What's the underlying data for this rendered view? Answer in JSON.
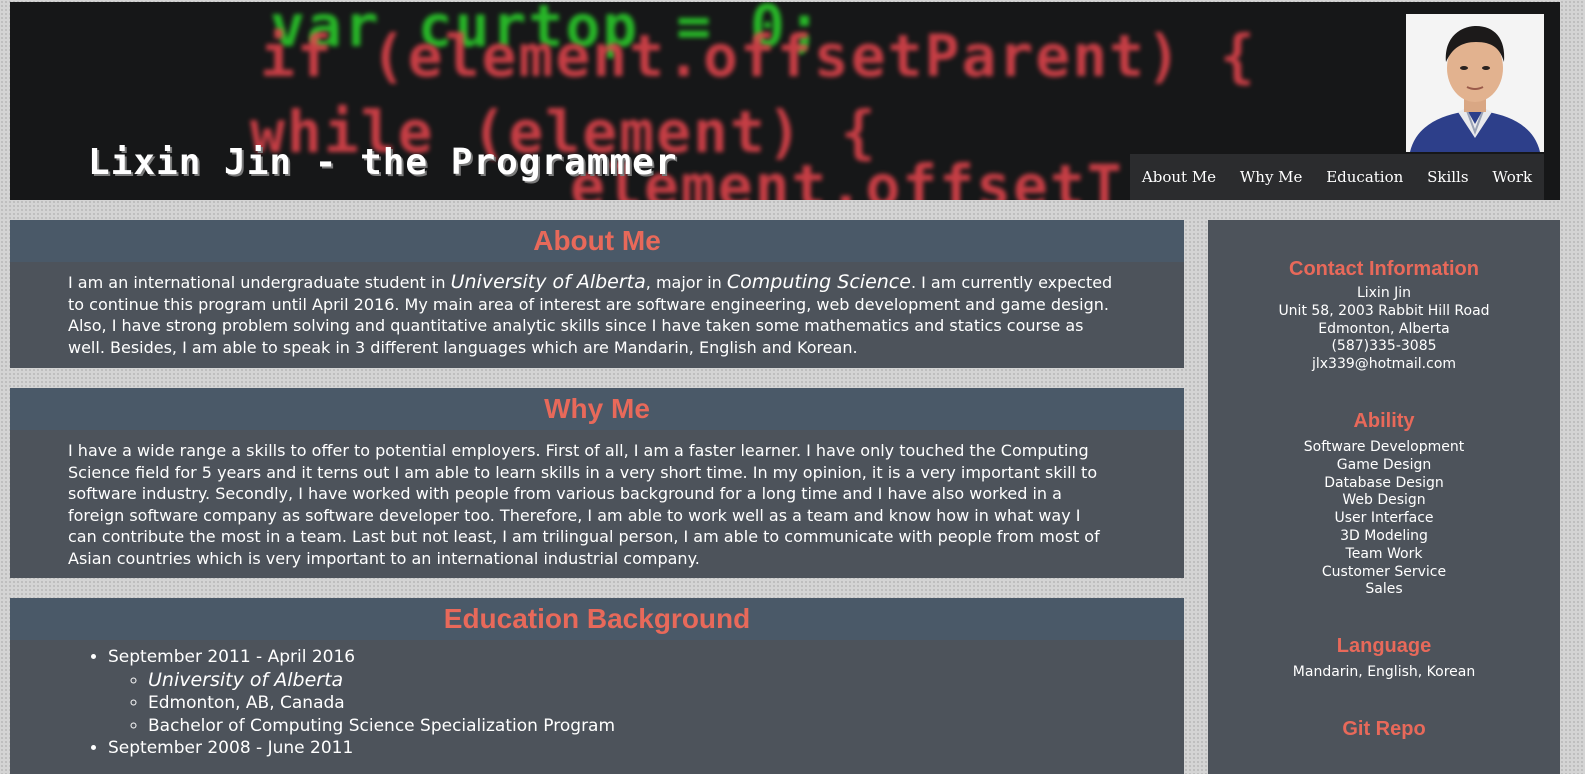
{
  "header": {
    "title": "Lixin Jin - the Programmer",
    "background_code": [
      {
        "text": "var curtop = 0;",
        "color": "#2bd22b"
      },
      {
        "text": "if (element.offsetParent)  {",
        "color": "#e5454d"
      },
      {
        "text": "while (element)  {",
        "color": "#e5454d"
      },
      {
        "text": "element.offsetT",
        "color": "#e5454d"
      }
    ]
  },
  "nav": {
    "items": [
      {
        "label": "About Me"
      },
      {
        "label": "Why Me"
      },
      {
        "label": "Education"
      },
      {
        "label": "Skills"
      },
      {
        "label": "Work"
      }
    ]
  },
  "about": {
    "heading": "About Me",
    "t1": "I am an international undergraduate student in ",
    "em1": "University of Alberta",
    "t2": ", major in ",
    "em2": "Computing Science",
    "t3": ". I am currently expected to continue this program until April 2016. My main area of interest are software engineering, web development and game design. Also, I have strong problem solving and quantitative analytic skills since I have taken some mathematics and statics course as well. Besides, I am able to speak in 3 different languages which are Mandarin, English and Korean."
  },
  "why": {
    "heading": "Why Me",
    "body": "I have a wide range a skills to offer to potential employers. First of all, I am a faster learner. I have only touched the Computing Science field for 5 years and it terns out I am able to learn skills in a very short time. In my opinion, it is a very important skill to software industry. Secondly, I have worked with people from various background for a long time and I have also worked in a foreign software company as software developer too. Therefore, I am able to work well as a team and know how in what way I can contribute the most in a team. Last but not least, I am trilingual person, I am able to communicate with people from most of Asian countries which is very important to an international industrial company."
  },
  "education": {
    "heading": "Education Background",
    "entries": [
      {
        "period": "September 2011 - April 2016",
        "school": "University of Alberta",
        "location": "Edmonton, AB, Canada",
        "program": "Bachelor of Computing Science Specialization Program"
      },
      {
        "period": "September 2008 - June 2011"
      }
    ]
  },
  "sidebar": {
    "contact": {
      "heading": "Contact Information",
      "name": "Lixin Jin",
      "address": "Unit 58, 2003 Rabbit Hill Road",
      "city": "Edmonton, Alberta",
      "phone": "(587)335-3085",
      "email": "jlx339@hotmail.com"
    },
    "ability": {
      "heading": "Ability",
      "items": [
        "Software Development",
        "Game Design",
        "Database Design",
        "Web Design",
        "User Interface",
        "3D Modeling",
        "Team Work",
        "Customer Service",
        "Sales"
      ]
    },
    "language": {
      "heading": "Language",
      "value": "Mandarin, English, Korean"
    },
    "git": {
      "heading": "Git Repo"
    }
  },
  "colors": {
    "accent": "#e8695a",
    "panel": "#4d535b",
    "panel_header": "#4a5968",
    "nav_bg": "#2b2c2e"
  }
}
